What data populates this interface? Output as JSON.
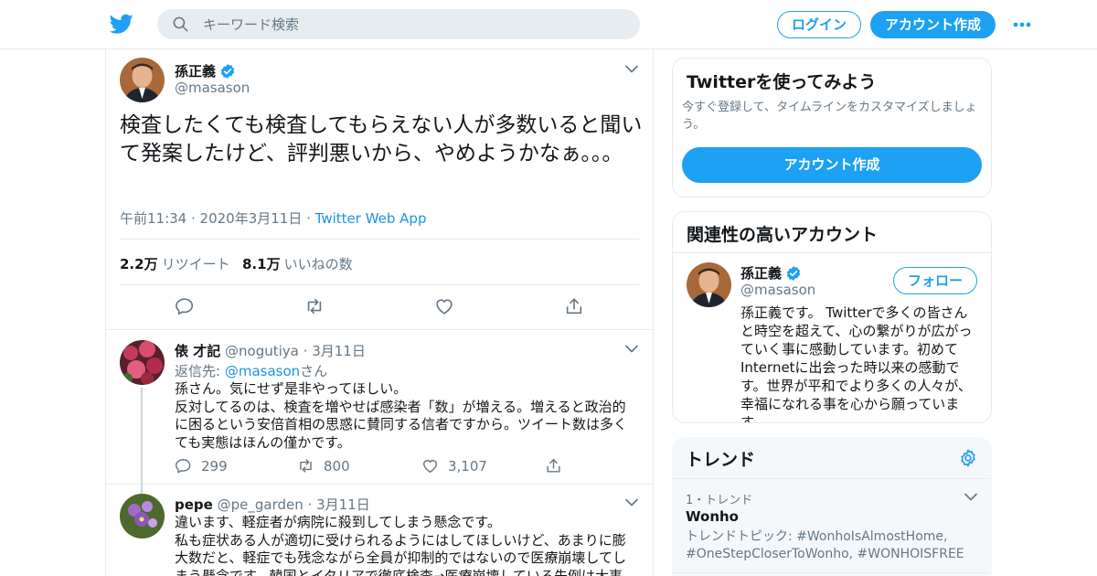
{
  "header": {
    "search_placeholder": "キーワード検索",
    "login_label": "ログイン",
    "signup_label": "アカウント作成"
  },
  "tweet": {
    "author_name": "孫正義",
    "author_handle": "@masason",
    "text": "検査したくても検査してもらえない人が多数いると聞いて発案したけど、評判悪いから、やめようかなぁ。。。",
    "time": "午前11:34 · 2020年3月11日 · ",
    "app": "Twitter Web App",
    "retweets_count": "2.2万",
    "retweets_label": "リツイート",
    "likes_count": "8.1万",
    "likes_label": "いいねの数"
  },
  "replies": [
    {
      "name": "俵 才記",
      "handle": "@nogutiya",
      "date": "3月11日",
      "reply_to_prefix": "返信先: ",
      "reply_to_handle": "@masason",
      "reply_to_suffix": "さん",
      "text": "孫さん。気にせず是非やってほしい。\n反対してるのは、検査を増やせば感染者「数」が増える。増えると政治的に困るという安倍首相の思惑に賛同する信者ですから。ツイート数は多くても実態はほんの僅かです。",
      "reply_count": "299",
      "retweet_count": "800",
      "like_count": "3,107"
    },
    {
      "name": "pepe",
      "handle": "@pe_garden",
      "date": "3月11日",
      "text": "違います、軽症者が病院に殺到してしまう懸念です。\n私も症状ある人が適切に受けられるようにはしてほしいけど、あまりに膨大数だと、軽症でも残念ながら全員が抑制的ではないので医療崩壊してしまう懸念です。韓国とイタリアで徹底検査→医療崩壊している先例は大事"
    }
  ],
  "sidebar": {
    "signup_card": {
      "title": "Twitterを使ってみよう",
      "description": "今すぐ登録して、タイムラインをカスタマイズしましょう。",
      "button": "アカウント作成"
    },
    "related": {
      "title": "関連性の高いアカウント",
      "name": "孫正義",
      "handle": "@masason",
      "follow_label": "フォロー",
      "bio": "孫正義です。 Twitterで多くの皆さんと時空を超えて、心の繋がりが広がっていく事に感動しています。初めてInternetに出会った時以来の感動です。世界が平和でより多くの人々が、幸福になれる事を心から願っています。"
    },
    "trends": {
      "title": "トレンド",
      "rank": "1・トレンド",
      "name": "Wonho",
      "description": "トレンドトピック: #WonhoIsAlmostHome, #OneStepCloserToWonho, #WONHOISFREE"
    }
  },
  "colors": {
    "accent": "#1da1f2",
    "link": "#1b95e0",
    "muted": "#657786",
    "border": "#e6ecf0"
  }
}
